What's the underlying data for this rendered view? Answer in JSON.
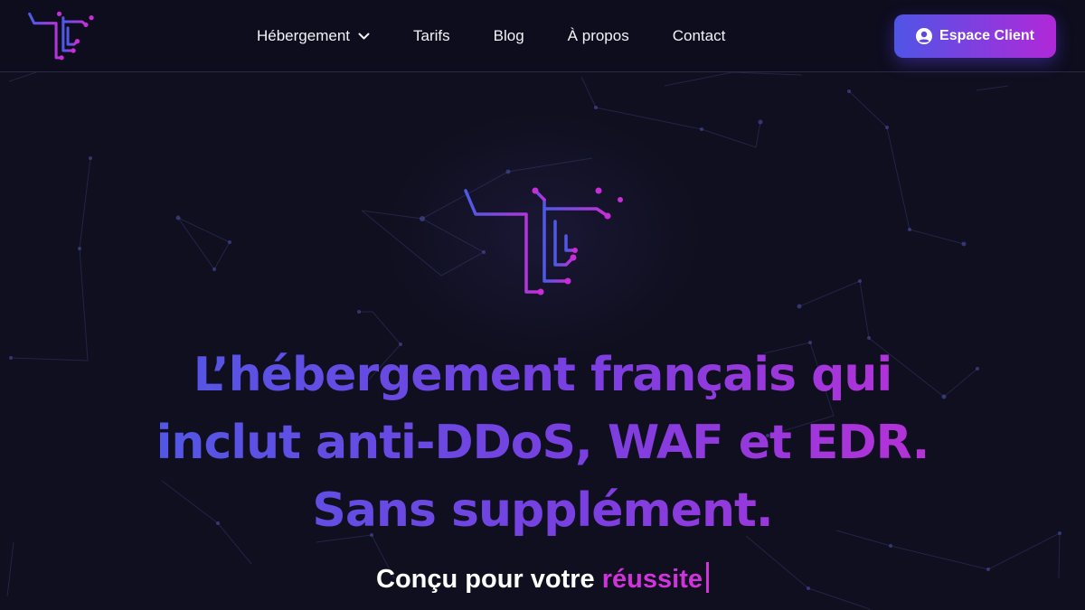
{
  "colors": {
    "accent_start": "#4f55e6",
    "accent_end": "#b128d8",
    "highlight": "#d033d9",
    "background": "#0f0f1f"
  },
  "nav": {
    "items": [
      {
        "label": "Hébergement",
        "has_dropdown": true
      },
      {
        "label": "Tarifs"
      },
      {
        "label": "Blog"
      },
      {
        "label": "À propos"
      },
      {
        "label": "Contact"
      }
    ]
  },
  "client_button": {
    "label": "Espace Client",
    "icon": "user-circle-icon"
  },
  "hero": {
    "headline_lines": [
      "L’hébergement français qui",
      "inclut anti-DDoS, WAF et EDR.",
      "Sans supplément."
    ],
    "tagline_prefix": "Conçu pour votre",
    "tagline_highlight": "réussite"
  }
}
